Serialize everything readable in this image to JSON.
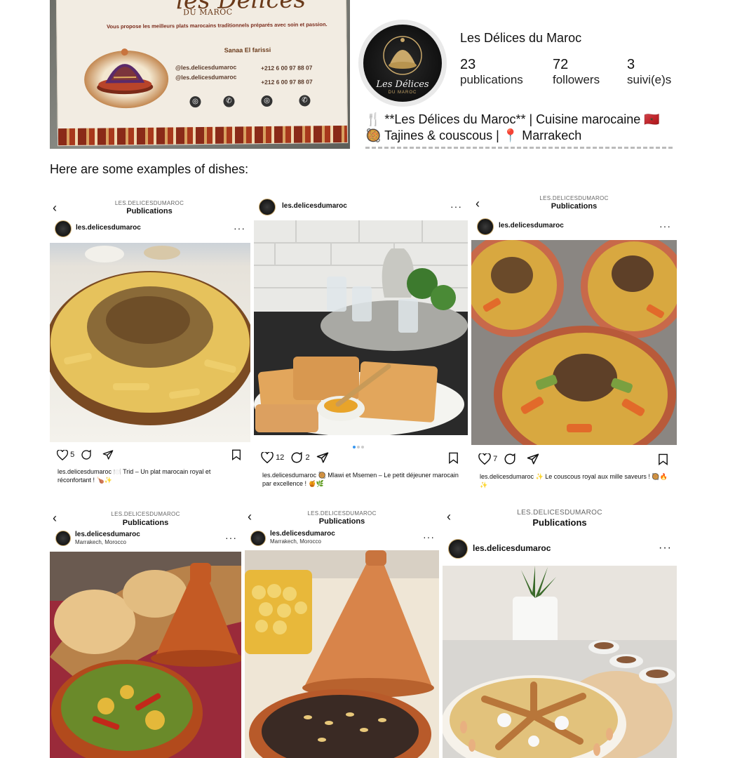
{
  "card": {
    "brand": "les Délices",
    "brand_sub": "DU MAROC",
    "tagline": "Vous propose les meilleurs plats marocains traditionnels préparés avec soin et passion.",
    "owner": "Sanaa El farissi",
    "handles": [
      "@les.delicesdumaroc",
      "@les.delicesdumaroc"
    ],
    "phones": [
      "+212 6 00 97 88 07",
      "+212 6 00 97 88 07"
    ]
  },
  "profile": {
    "avatar_logo": "Les Délices",
    "avatar_logo_sub": "DU MAROC",
    "name": "Les Délices du Maroc",
    "stats": [
      {
        "num": "23",
        "label": "publications"
      },
      {
        "num": "72",
        "label": "followers"
      },
      {
        "num": "3",
        "label": "suivi(e)s"
      }
    ],
    "bio_line1": "🍴 **Les Délices du Maroc** | Cuisine marocaine 🇲🇦",
    "bio_line2": "🥘 Tajines & couscous | 📍 Marrakech"
  },
  "intro": "Here are some examples of dishes:",
  "posts": [
    {
      "kicker": "LES.DELICESDUMAROC",
      "title": "Publications",
      "user": "les.delicesdumaroc",
      "location": "",
      "likes": "5",
      "comments": "",
      "caption_user": "les.delicesdumaroc",
      "caption": "🍽️ Trid – Un plat marocain royal et réconfortant ! 🍗✨"
    },
    {
      "kicker": "",
      "title": "",
      "user": "les.delicesdumaroc",
      "location": "",
      "likes": "12",
      "comments": "2",
      "caption_user": "les.delicesdumaroc",
      "caption": "🥘 Mlawi et Msemen – Le petit déjeuner marocain par excellence ! 🍯🌿"
    },
    {
      "kicker": "LES.DELICESDUMAROC",
      "title": "Publications",
      "user": "les.delicesdumaroc",
      "location": "",
      "likes": "7",
      "comments": "",
      "caption_user": "les.delicesdumaroc",
      "caption": "✨ Le couscous royal aux mille saveurs ! 🥘🔥✨"
    },
    {
      "kicker": "LES.DELICESDUMAROC",
      "title": "Publications",
      "user": "les.delicesdumaroc",
      "location": "Marrakech, Morocco"
    },
    {
      "kicker": "LES.DELICESDUMAROC",
      "title": "Publications",
      "user": "les.delicesdumaroc",
      "location": "Marrakech, Morocco"
    },
    {
      "kicker": "LES.DELICESDUMAROC",
      "title": "Publications",
      "user": "les.delicesdumaroc",
      "location": ""
    }
  ],
  "colors": {
    "card_bg": "#f2ece2",
    "card_text": "#6a3a1a",
    "tagine_terracotta": "#c8743e",
    "couscous_yellow": "#e3b84a",
    "carousel_active": "#3897f0"
  },
  "icons": [
    "heart-icon",
    "comment-icon",
    "share-icon",
    "bookmark-icon",
    "back-chevron-icon",
    "more-icon",
    "instagram-icon",
    "whatsapp-icon"
  ]
}
